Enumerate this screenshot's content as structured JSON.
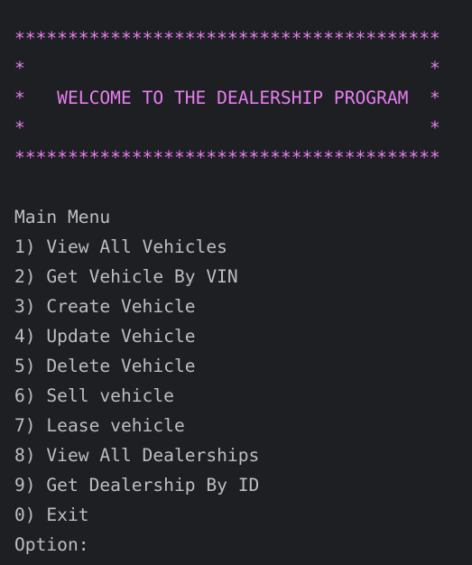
{
  "banner": {
    "top_border": "****************************************",
    "spacer_1": "*                                      *",
    "title_line": "*   WELCOME TO THE DEALERSHIP PROGRAM  *",
    "spacer_2": "*                                      *",
    "bottom_border": "****************************************"
  },
  "menu": {
    "heading": "Main Menu",
    "items": [
      {
        "label": "1) View All Vehicles"
      },
      {
        "label": "2) Get Vehicle By VIN"
      },
      {
        "label": "3) Create Vehicle"
      },
      {
        "label": "4) Update Vehicle"
      },
      {
        "label": "5) Delete Vehicle"
      },
      {
        "label": "6) Sell vehicle"
      },
      {
        "label": "7) Lease vehicle"
      },
      {
        "label": "8) View All Dealerships"
      },
      {
        "label": "9) Get Dealership By ID"
      },
      {
        "label": "0) Exit"
      }
    ],
    "prompt": "Option:"
  },
  "colors": {
    "background": "#1e1f22",
    "banner": "#e67ef0",
    "text": "#bcbec4"
  }
}
